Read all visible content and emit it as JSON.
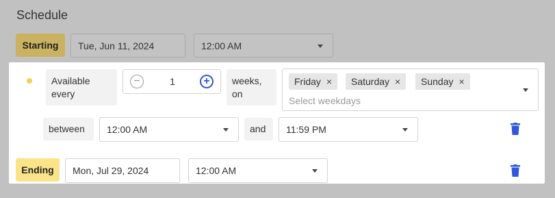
{
  "section": {
    "title": "Schedule"
  },
  "starting": {
    "tag": "Starting",
    "date": "Tue, Jun 11, 2024",
    "time": "12:00 AM"
  },
  "rule": {
    "available_label": "Available every",
    "count": "1",
    "unit_label": "weeks, on",
    "weekdays": [
      {
        "label": "Friday",
        "remove": "×"
      },
      {
        "label": "Saturday",
        "remove": "×"
      },
      {
        "label": "Sunday",
        "remove": "×"
      }
    ],
    "weekday_placeholder": "Select weekdays",
    "between_label": "between",
    "start_time": "12:00 AM",
    "and_label": "and",
    "end_time": "11:59 PM"
  },
  "ending": {
    "tag": "Ending",
    "date": "Mon, Jul 29, 2024",
    "time": "12:00 AM"
  },
  "icons": {
    "minus": "−",
    "plus": "+"
  },
  "colors": {
    "accent": "#3058d9",
    "starting_tag": "#cbb260",
    "ending_tag": "#fbe38a",
    "status_dot": "#f4d155",
    "background": "#c1c1c1"
  }
}
